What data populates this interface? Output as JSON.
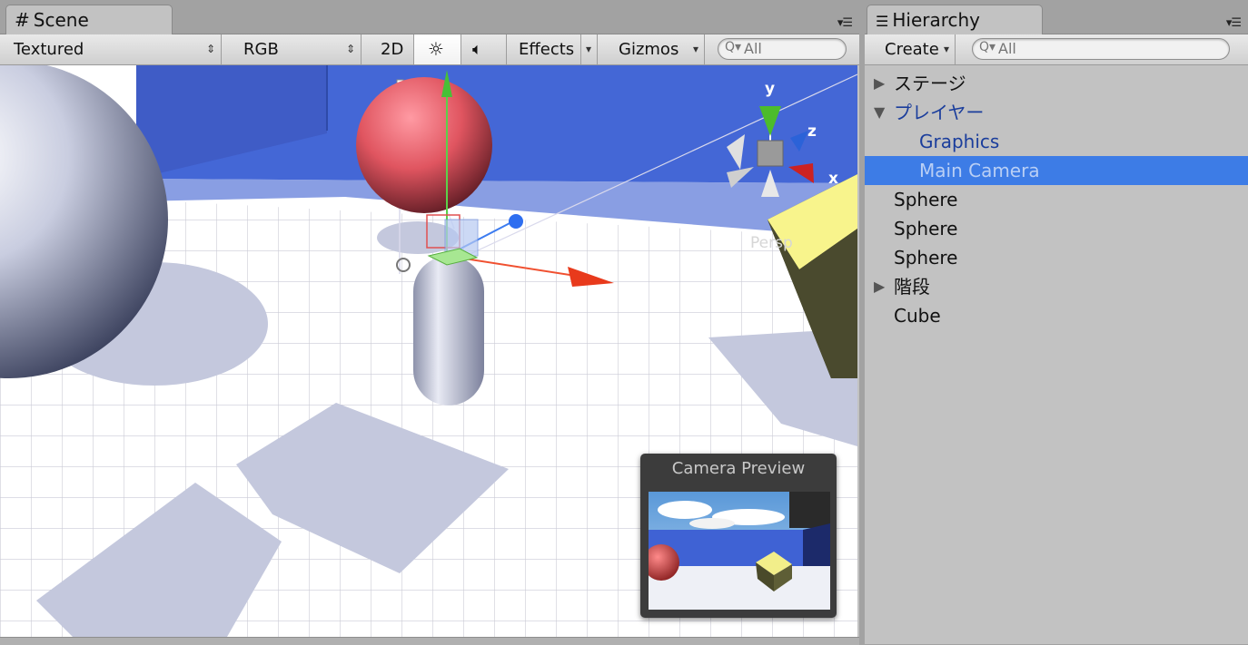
{
  "scene": {
    "tab_label": "Scene",
    "toolbar": {
      "render_mode": "Textured",
      "color_mode": "RGB",
      "mode_2d": "2D",
      "effects_label": "Effects",
      "gizmos_label": "Gizmos",
      "search_placeholder": "All"
    },
    "view_label": "Persp",
    "axis_labels": {
      "x": "x",
      "y": "y",
      "z": "z"
    },
    "camera_preview_title": "Camera Preview"
  },
  "hierarchy": {
    "tab_label": "Hierarchy",
    "create_label": "Create",
    "search_placeholder": "All",
    "items": [
      {
        "label": "ステージ",
        "expandable": true,
        "expanded": false,
        "depth": 0,
        "selected": false,
        "style": "normal"
      },
      {
        "label": "プレイヤー",
        "expandable": true,
        "expanded": true,
        "depth": 0,
        "selected": false,
        "style": "prefab"
      },
      {
        "label": "Graphics",
        "expandable": false,
        "depth": 1,
        "selected": false,
        "style": "prefab"
      },
      {
        "label": "Main Camera",
        "expandable": false,
        "depth": 1,
        "selected": true,
        "style": "prefab"
      },
      {
        "label": "Sphere",
        "expandable": false,
        "depth": 0,
        "selected": false,
        "style": "normal"
      },
      {
        "label": "Sphere",
        "expandable": false,
        "depth": 0,
        "selected": false,
        "style": "normal"
      },
      {
        "label": "Sphere",
        "expandable": false,
        "depth": 0,
        "selected": false,
        "style": "normal"
      },
      {
        "label": "階段",
        "expandable": true,
        "expanded": false,
        "depth": 0,
        "selected": false,
        "style": "normal"
      },
      {
        "label": "Cube",
        "expandable": false,
        "depth": 0,
        "selected": false,
        "style": "normal"
      }
    ]
  },
  "colors": {
    "selection": "#3d7ce6",
    "prefab_text": "#1a3d9c",
    "selected_prefab_text": "#b9cff5",
    "sky_wall": "#4467d6"
  }
}
